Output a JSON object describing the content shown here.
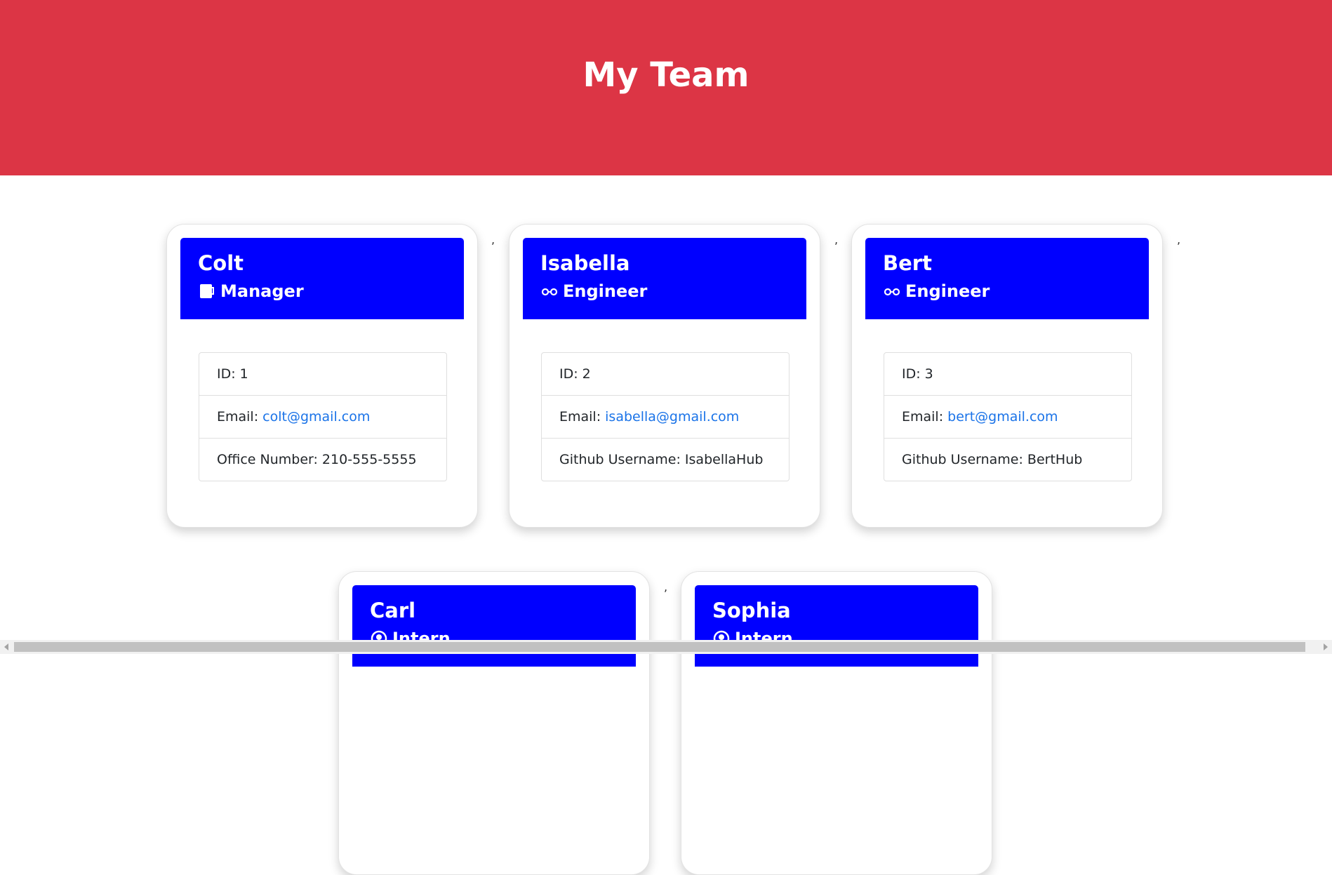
{
  "header": {
    "title": "My Team"
  },
  "separator": ",",
  "colors": {
    "header_bg": "#dc3545",
    "card_header_bg": "#0000ff",
    "link": "#1a73e8"
  },
  "employees": [
    {
      "name": "Colt",
      "role": "Manager",
      "icon": "mug-icon",
      "id_label": "ID: 1",
      "email_prefix": "Email: ",
      "email": "colt@gmail.com",
      "extra": "Office Number: 210-555-5555"
    },
    {
      "name": "Isabella",
      "role": "Engineer",
      "icon": "glasses-icon",
      "id_label": "ID: 2",
      "email_prefix": "Email: ",
      "email": "isabella@gmail.com",
      "extra": "Github Username: IsabellaHub"
    },
    {
      "name": "Bert",
      "role": "Engineer",
      "icon": "glasses-icon",
      "id_label": "ID: 3",
      "email_prefix": "Email: ",
      "email": "bert@gmail.com",
      "extra": "Github Username: BertHub"
    },
    {
      "name": "Carl",
      "role": "Intern",
      "icon": "user-graduate-icon"
    },
    {
      "name": "Sophia",
      "role": "Intern",
      "icon": "user-graduate-icon"
    }
  ]
}
